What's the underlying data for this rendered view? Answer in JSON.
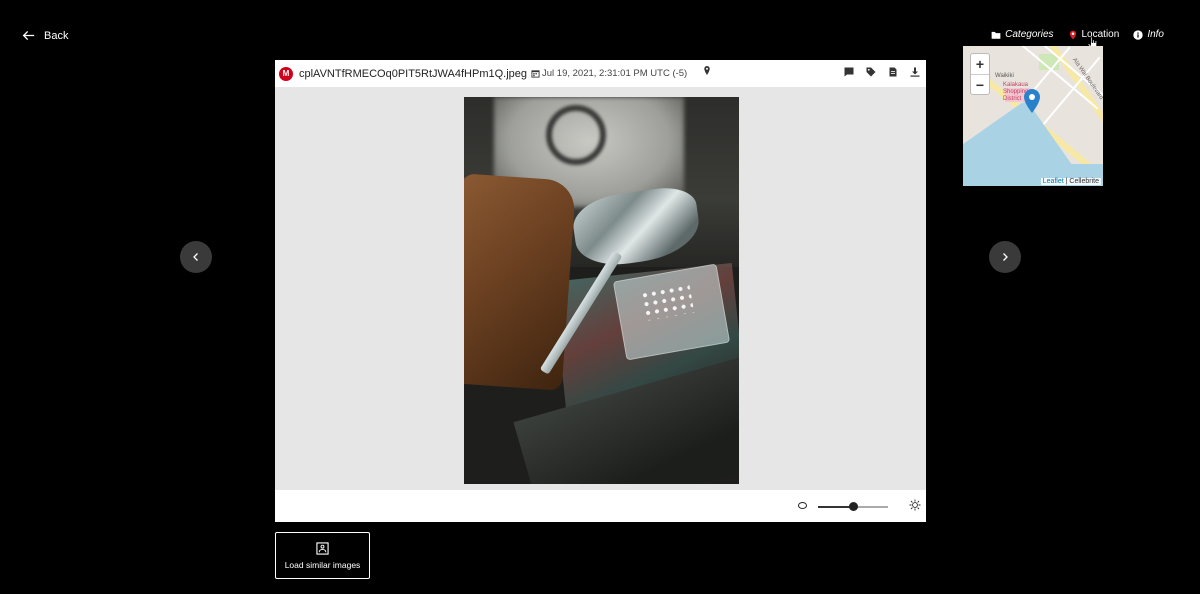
{
  "nav": {
    "back_label": "Back",
    "categories_label": "Categories",
    "location_label": "Location",
    "info_label": "Info"
  },
  "viewer": {
    "app_logo": "M",
    "filename": "cplAVNTfRMECOq0PIT5RtJWA4fHPm1Q.jpeg",
    "timestamp": "Jul 19, 2021, 2:31:01 PM UTC (-5)",
    "header_icons": [
      "comment-icon",
      "tag-icon",
      "file-icon",
      "download-icon"
    ],
    "image_toolbar": [
      "rotate-left-icon",
      "rotate-right-icon",
      "zoom-out-icon",
      "zoom-in-icon",
      "fit-icon"
    ],
    "contrast_level": 0.5
  },
  "map": {
    "zoom_in": "+",
    "zoom_out": "−",
    "attribution_leaflet": "Leaflet",
    "attribution_separator": " | ",
    "attribution_provider": "Cellebrite",
    "label_district": "Waikiki",
    "label_place": "Kalakaua Shopping District",
    "label_street": "Ala Wai Boulevard"
  },
  "similar": {
    "button_label": "Load similar images"
  },
  "colors": {
    "background": "#000000",
    "image_bg": "#e6e6e6",
    "logo_red": "#d0021b",
    "map_pin": "#2a81cb"
  }
}
